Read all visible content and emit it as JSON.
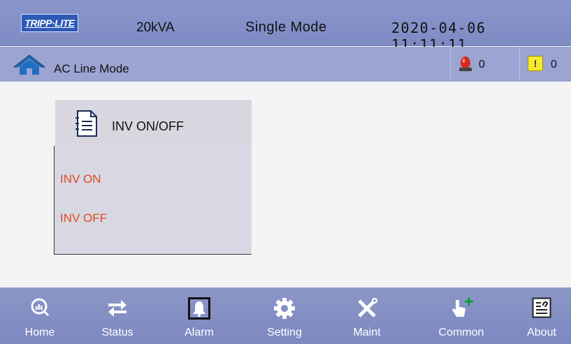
{
  "header": {
    "logo_text": "TRIPP·LITE",
    "capacity": "20kVA",
    "mode": "Single Mode",
    "datetime": "2020-04-06  11:11:11"
  },
  "status_bar": {
    "label": "AC Line Mode",
    "alarm_count": "0",
    "warning_count": "0",
    "warning_glyph": "!"
  },
  "panel": {
    "title": "INV ON/OFF",
    "options": [
      "INV ON",
      "INV OFF"
    ],
    "option_color": "#e2481d"
  },
  "nav": {
    "items": [
      {
        "label": "Home",
        "icon": "home-magnifier-icon"
      },
      {
        "label": "Status",
        "icon": "swap-arrows-icon"
      },
      {
        "label": "Alarm",
        "icon": "bell-icon"
      },
      {
        "label": "Setting",
        "icon": "gear-icon"
      },
      {
        "label": "Maint",
        "icon": "wrench-screwdriver-icon"
      },
      {
        "label": "Common",
        "icon": "hand-pointer-plus-icon"
      },
      {
        "label": "About",
        "icon": "info-document-icon"
      }
    ]
  },
  "colors": {
    "topbar": "#8a96cb",
    "modebar": "#9ca4d2",
    "navbar": "#7c88c0",
    "panel_bg": "#d7d8e3",
    "background": "#f4f4f4"
  }
}
